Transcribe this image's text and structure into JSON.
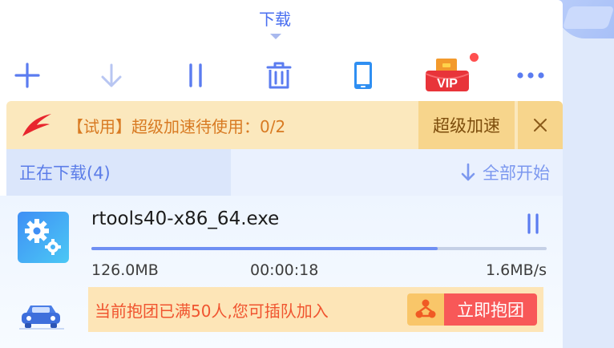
{
  "tab": {
    "title": "下载"
  },
  "toolbar": {
    "vip_label": "VIP"
  },
  "notice": {
    "text": "【试用】超级加速待使用：0/2",
    "speed_button": "超级加速"
  },
  "section": {
    "downloading_label": "正在下载(4)",
    "start_all_label": "全部开始"
  },
  "download": {
    "file_name": "rtools40-x86_64.exe",
    "size": "126.0MB",
    "time": "00:00:18",
    "speed": "1.6MB/s",
    "progress_percent": 76
  },
  "promo": {
    "text": "当前抱团已满50人,您可插队加入",
    "button": "立即抱团"
  },
  "colors": {
    "accent": "#4a6ff0",
    "icon": "#5b7cf0",
    "progress": "#6f8ff3",
    "promo_button": "#f85858"
  }
}
